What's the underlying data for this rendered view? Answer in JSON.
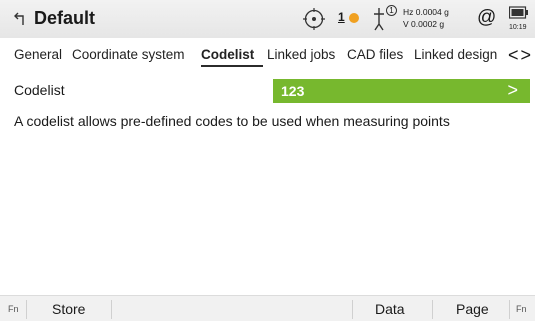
{
  "window": {
    "title": "Default"
  },
  "status": {
    "prism_count": "1",
    "atmo_badge": "1",
    "hz_label": "Hz 0.0004 g",
    "v_label": "V  0.0002 g",
    "at_symbol": "@",
    "time": "10:19"
  },
  "tabs": [
    {
      "label": "General"
    },
    {
      "label": "Coordinate system"
    },
    {
      "label": "Codelist"
    },
    {
      "label": "Linked jobs"
    },
    {
      "label": "CAD files"
    },
    {
      "label": "Linked design"
    }
  ],
  "tab_nav": {
    "prev": "<",
    "next": ">"
  },
  "codelist": {
    "label": "Codelist",
    "value": "123",
    "chevron": ">"
  },
  "description": "A codelist allows pre-defined codes to be used when measuring points",
  "softkeys": {
    "fn_left": "Fn",
    "store": "Store",
    "data": "Data",
    "page": "Page",
    "fn_right": "Fn"
  },
  "colors": {
    "accent": "#77b82e",
    "title_bar": "#e9e9e9"
  }
}
